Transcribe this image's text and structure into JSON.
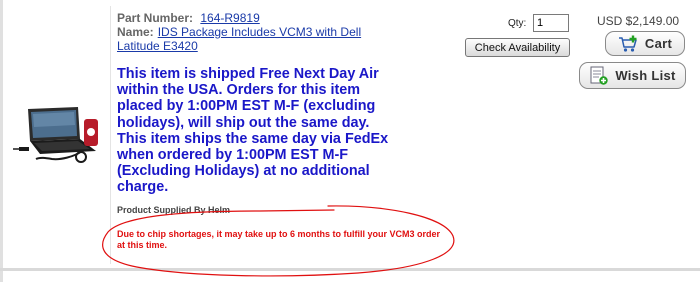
{
  "product": {
    "part_label": "Part Number:",
    "part_number": "164-R9819",
    "name_label": "Name:",
    "name": "IDS Package Includes VCM3 with Dell Latitude E3420",
    "shipping_notice": "This item is shipped Free Next Day Air within the USA. Orders for this item placed by 1:00PM EST M-F (excluding holidays), will ship out the same day. This item ships the same day via FedEx when ordered by 1:00PM EST M-F (Excluding Holidays) at no additional charge.",
    "supplied_by": "Product Supplied By Helm",
    "chip_note": "Due to chip shortages, it may take up to 6 months to fulfill your VCM3 order at this time."
  },
  "order": {
    "qty_label": "Qty:",
    "qty_value": "1",
    "check_label": "Check Availability",
    "price": "USD $2,149.00",
    "cart_label": "Cart",
    "wish_label": "Wish List"
  },
  "colors": {
    "link": "#1a3aa8",
    "shipping_text": "#1a17c8",
    "warning_text": "#e01010",
    "annotation_ellipse": "#e01010",
    "cart_plus": "#22a022"
  },
  "icons": {
    "cart": "shopping-cart-icon",
    "wish": "wish-list-icon"
  }
}
